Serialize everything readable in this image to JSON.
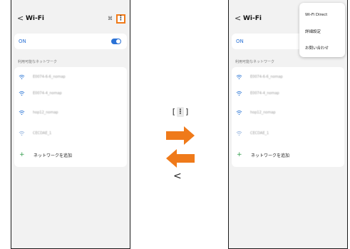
{
  "colors": {
    "accent_orange": "#ef7a1a",
    "toggle_blue": "#2b72d6",
    "add_green": "#2e9b4a"
  },
  "left_screen": {
    "title": "Wi-Fi",
    "back_icon": "chevron-left-icon",
    "mute_icon": "⌘",
    "menu_icon": "⋮",
    "on_label": "ON",
    "section_label": "利用可能なネットワーク",
    "networks": [
      "E0074-6-6_nomap",
      "E0074-4_nomap",
      "hop12_nomap",
      "CECDAE_1"
    ],
    "add_network": "ネットワークを追加"
  },
  "right_screen": {
    "title": "Wi-Fi",
    "on_label": "ON",
    "section_label": "利用可能なネットワーク",
    "networks": [
      "E0074-6-6_nomap",
      "E0074-4_nomap",
      "hop12_nomap",
      "CECDAE_1"
    ],
    "add_network": "ネットワークを追加",
    "menu_items": [
      "Wi-Fi Direct",
      "詳細設定",
      "お問い合わせ"
    ]
  },
  "center": {
    "bracket_left": "[",
    "menu_key": "⋮",
    "bracket_right": "]",
    "back_chevron": "<"
  }
}
